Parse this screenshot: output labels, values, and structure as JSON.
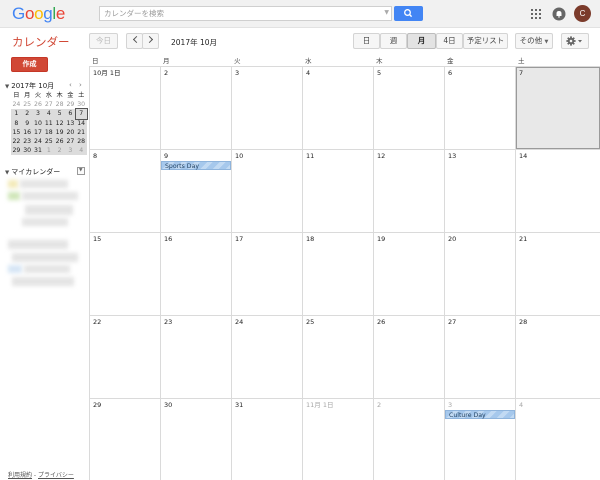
{
  "header": {
    "logo": "Google",
    "logo_colors": [
      "#4285f4",
      "#ea4335",
      "#fbbc05",
      "#4285f4",
      "#34a853",
      "#ea4335"
    ],
    "search_placeholder": "カレンダーを検索",
    "avatar_letter": "C",
    "icons": [
      "search-icon",
      "apps-grid-icon",
      "notifications-icon"
    ]
  },
  "toolbar": {
    "app_title": "カレンダー",
    "today_label": "今日",
    "current_label": "2017年 10月",
    "views": [
      "日",
      "週",
      "月",
      "4日",
      "予定リスト"
    ],
    "selected_view": "月",
    "more_label": "その他",
    "icons": [
      "chevron-left-icon",
      "chevron-right-icon",
      "settings-gear-icon"
    ]
  },
  "sidebar": {
    "create_label": "作成",
    "mini_calendar": {
      "title": "2017年 10月",
      "weekdays": [
        "日",
        "月",
        "火",
        "水",
        "木",
        "金",
        "土"
      ],
      "weeks": [
        [
          "24",
          "25",
          "26",
          "27",
          "28",
          "29",
          "30"
        ],
        [
          "1",
          "2",
          "3",
          "4",
          "5",
          "6",
          "7"
        ],
        [
          "8",
          "9",
          "10",
          "11",
          "12",
          "13",
          "14"
        ],
        [
          "15",
          "16",
          "17",
          "18",
          "19",
          "20",
          "21"
        ],
        [
          "22",
          "23",
          "24",
          "25",
          "26",
          "27",
          "28"
        ],
        [
          "29",
          "30",
          "31",
          "1",
          "2",
          "3",
          "4"
        ]
      ],
      "today": "7"
    },
    "my_calendars_label": "マイカレンダー",
    "footer_terms": "利用規約",
    "footer_separator": " - ",
    "footer_privacy": "プライバシー"
  },
  "month": {
    "weekdays": [
      "日",
      "月",
      "火",
      "水",
      "木",
      "金",
      "土"
    ],
    "weeks": [
      [
        "10月 1日",
        "2",
        "3",
        "4",
        "5",
        "6",
        "7"
      ],
      [
        "8",
        "9",
        "10",
        "11",
        "12",
        "13",
        "14"
      ],
      [
        "15",
        "16",
        "17",
        "18",
        "19",
        "20",
        "21"
      ],
      [
        "22",
        "23",
        "24",
        "25",
        "26",
        "27",
        "28"
      ],
      [
        "29",
        "30",
        "31",
        "11月 1日",
        "2",
        "3",
        "4"
      ]
    ],
    "today": "7",
    "events": [
      {
        "title": "Sports Day",
        "week": 1,
        "day": 1
      },
      {
        "title": "Culture Day",
        "week": 4,
        "day": 5
      }
    ],
    "event_color": "#a6c8ec"
  }
}
